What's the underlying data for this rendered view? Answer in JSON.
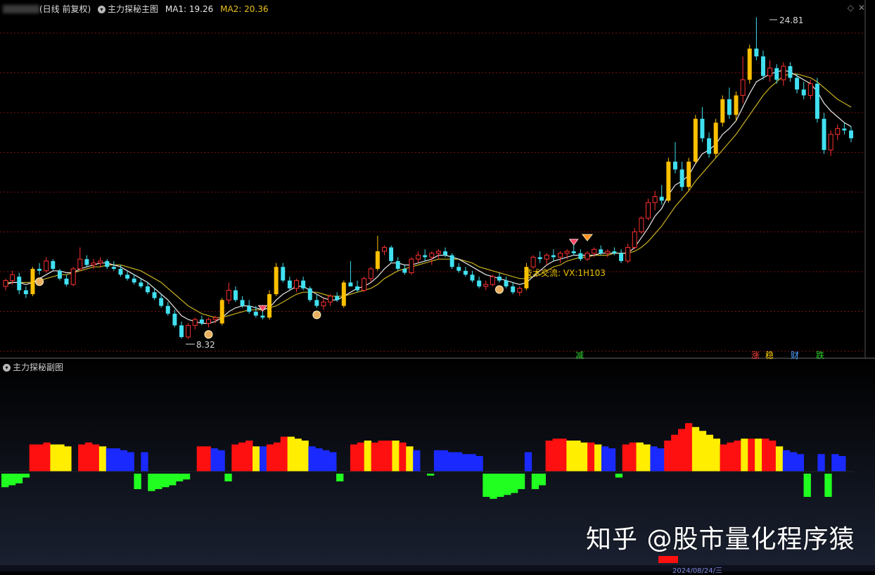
{
  "header": {
    "period_label": "(日线 前复权)",
    "indicator_name": "主力探秘主图",
    "ma1": "MA1: 19.26",
    "ma2": "MA2: 20.36"
  },
  "main_chart": {
    "high_label": "24.81",
    "low_label": "8.32",
    "annotation": "技术交流: VX:1H103",
    "signals": [
      {
        "text": "减",
        "color": "#30d030"
      },
      {
        "text": "涨",
        "color": "#ff4040"
      },
      {
        "text": "稳",
        "color": "#ffd000"
      },
      {
        "text": "财",
        "color": "#4aa0ff"
      },
      {
        "text": "跌",
        "color": "#30d030"
      }
    ]
  },
  "sub_chart": {
    "title": "主力探秘副图"
  },
  "watermark": "知乎 @股市量化程序猿",
  "footer": {
    "date_label": "2024/08/24/三"
  },
  "chart_data": {
    "type": "candlestick",
    "price_range": [
      6,
      26
    ],
    "ma1_color": "#e8e8e8",
    "ma2_color": "#c8b020",
    "candles": [
      [
        11.0,
        11.4,
        10.8,
        11.3
      ],
      [
        11.3,
        11.8,
        11.1,
        11.6
      ],
      [
        11.5,
        11.7,
        10.6,
        10.8
      ],
      [
        10.8,
        11.0,
        10.4,
        10.6
      ],
      [
        10.6,
        12.0,
        10.5,
        11.9
      ],
      [
        11.9,
        12.2,
        11.6,
        11.8
      ],
      [
        11.8,
        12.5,
        11.7,
        12.3
      ],
      [
        12.3,
        12.4,
        11.8,
        11.9
      ],
      [
        11.8,
        11.9,
        11.3,
        11.4
      ],
      [
        11.4,
        11.6,
        11.0,
        11.1
      ],
      [
        11.1,
        12.0,
        11.0,
        11.9
      ],
      [
        11.9,
        13.0,
        11.8,
        12.4
      ],
      [
        12.4,
        12.6,
        12.0,
        12.1
      ],
      [
        12.1,
        12.4,
        11.9,
        12.2
      ],
      [
        12.2,
        12.5,
        12.0,
        12.3
      ],
      [
        12.3,
        12.4,
        11.9,
        12.0
      ],
      [
        12.0,
        12.3,
        11.8,
        11.9
      ],
      [
        11.9,
        12.1,
        11.5,
        11.6
      ],
      [
        11.6,
        11.8,
        11.3,
        11.4
      ],
      [
        11.4,
        11.6,
        11.1,
        11.2
      ],
      [
        11.2,
        11.4,
        10.9,
        11.0
      ],
      [
        11.0,
        11.2,
        10.6,
        10.7
      ],
      [
        10.7,
        10.9,
        10.3,
        10.4
      ],
      [
        10.4,
        10.6,
        9.9,
        10.0
      ],
      [
        10.0,
        10.2,
        9.5,
        9.6
      ],
      [
        9.6,
        9.8,
        8.9,
        9.0
      ],
      [
        9.0,
        9.2,
        8.32,
        8.4
      ],
      [
        8.4,
        9.1,
        8.3,
        9.0
      ],
      [
        9.0,
        9.4,
        8.8,
        9.3
      ],
      [
        9.3,
        9.5,
        9.0,
        9.1
      ],
      [
        9.1,
        9.4,
        8.9,
        9.3
      ],
      [
        9.3,
        9.5,
        9.1,
        9.4
      ],
      [
        9.1,
        10.4,
        9.0,
        10.3
      ],
      [
        10.3,
        11.2,
        10.1,
        10.8
      ],
      [
        10.8,
        11.0,
        10.2,
        10.3
      ],
      [
        10.3,
        10.5,
        9.9,
        10.0
      ],
      [
        10.0,
        10.3,
        9.6,
        9.7
      ],
      [
        9.7,
        10.0,
        9.4,
        9.5
      ],
      [
        9.5,
        9.8,
        9.3,
        9.4
      ],
      [
        9.4,
        10.8,
        9.3,
        10.6
      ],
      [
        10.6,
        12.2,
        10.5,
        12.0
      ],
      [
        12.0,
        12.2,
        11.2,
        11.3
      ],
      [
        11.3,
        11.5,
        10.8,
        10.9
      ],
      [
        10.9,
        11.4,
        10.7,
        11.3
      ],
      [
        11.3,
        11.5,
        10.8,
        10.9
      ],
      [
        10.9,
        11.0,
        10.2,
        10.3
      ],
      [
        10.3,
        10.6,
        9.9,
        10.0
      ],
      [
        10.0,
        10.4,
        9.8,
        10.2
      ],
      [
        10.2,
        10.6,
        10.0,
        10.5
      ],
      [
        10.5,
        10.7,
        10.2,
        10.3
      ],
      [
        10.0,
        11.3,
        9.9,
        11.2
      ],
      [
        11.2,
        12.3,
        11.0,
        11.0
      ],
      [
        11.0,
        11.3,
        10.7,
        10.8
      ],
      [
        10.8,
        11.5,
        10.7,
        11.4
      ],
      [
        11.4,
        12.0,
        11.2,
        11.9
      ],
      [
        11.9,
        13.6,
        11.8,
        12.8
      ],
      [
        12.8,
        13.1,
        12.6,
        13.0
      ],
      [
        13.0,
        13.1,
        12.2,
        12.3
      ],
      [
        12.3,
        12.5,
        11.8,
        11.9
      ],
      [
        11.9,
        12.1,
        11.6,
        11.7
      ],
      [
        11.7,
        12.5,
        11.6,
        12.4
      ],
      [
        12.4,
        12.8,
        12.2,
        12.6
      ],
      [
        12.6,
        12.9,
        12.3,
        12.5
      ],
      [
        12.5,
        12.8,
        12.1,
        12.7
      ],
      [
        12.7,
        12.9,
        12.4,
        12.8
      ],
      [
        12.8,
        13.0,
        12.5,
        12.6
      ],
      [
        12.6,
        12.7,
        11.9,
        12.0
      ],
      [
        12.0,
        12.2,
        11.7,
        11.8
      ],
      [
        11.8,
        12.0,
        11.5,
        11.6
      ],
      [
        11.6,
        11.8,
        11.2,
        11.3
      ],
      [
        11.3,
        11.5,
        10.9,
        11.0
      ],
      [
        11.0,
        11.3,
        10.8,
        11.1
      ],
      [
        11.1,
        11.6,
        11.0,
        11.5
      ],
      [
        11.5,
        11.7,
        11.2,
        11.3
      ],
      [
        11.3,
        11.5,
        10.9,
        11.0
      ],
      [
        11.0,
        11.2,
        10.6,
        10.7
      ],
      [
        10.7,
        11.0,
        10.5,
        10.9
      ],
      [
        10.9,
        12.2,
        10.8,
        12.0
      ],
      [
        12.0,
        12.6,
        11.9,
        12.5
      ],
      [
        12.5,
        12.8,
        12.2,
        12.4
      ],
      [
        12.4,
        12.7,
        12.1,
        12.6
      ],
      [
        12.6,
        12.9,
        12.3,
        12.5
      ],
      [
        12.5,
        12.8,
        12.2,
        12.7
      ],
      [
        12.7,
        12.9,
        12.4,
        12.8
      ],
      [
        12.8,
        13.2,
        12.6,
        12.7
      ],
      [
        12.7,
        12.9,
        12.3,
        12.4
      ],
      [
        12.4,
        12.8,
        12.3,
        12.7
      ],
      [
        12.7,
        13.0,
        12.5,
        12.9
      ],
      [
        12.9,
        13.1,
        12.6,
        12.7
      ],
      [
        12.7,
        12.9,
        12.5,
        12.8
      ],
      [
        12.8,
        13.0,
        12.6,
        12.7
      ],
      [
        12.7,
        12.9,
        12.2,
        12.3
      ],
      [
        12.3,
        13.2,
        12.2,
        13.0
      ],
      [
        13.0,
        14.0,
        12.9,
        13.8
      ],
      [
        13.8,
        14.6,
        13.7,
        14.5
      ],
      [
        14.5,
        15.5,
        14.4,
        15.3
      ],
      [
        15.3,
        15.9,
        14.9,
        15.6
      ],
      [
        15.6,
        16.2,
        15.2,
        15.4
      ],
      [
        15.4,
        17.6,
        15.3,
        17.4
      ],
      [
        17.4,
        18.4,
        16.8,
        17.0
      ],
      [
        17.0,
        17.4,
        15.9,
        16.1
      ],
      [
        16.1,
        17.6,
        15.9,
        17.4
      ],
      [
        17.4,
        19.8,
        17.3,
        19.6
      ],
      [
        19.6,
        20.2,
        18.4,
        18.6
      ],
      [
        18.6,
        18.9,
        17.6,
        17.8
      ],
      [
        17.8,
        19.6,
        17.6,
        19.4
      ],
      [
        19.4,
        20.8,
        19.2,
        20.6
      ],
      [
        20.6,
        21.2,
        19.6,
        19.8
      ],
      [
        19.8,
        21.0,
        19.5,
        20.8
      ],
      [
        20.8,
        22.8,
        20.4,
        21.6
      ],
      [
        21.6,
        23.4,
        21.4,
        23.2
      ],
      [
        23.2,
        24.81,
        22.6,
        22.8
      ],
      [
        22.8,
        23.1,
        21.6,
        21.8
      ],
      [
        21.8,
        22.6,
        21.5,
        22.2
      ],
      [
        22.2,
        22.4,
        21.4,
        21.6
      ],
      [
        21.6,
        22.5,
        21.3,
        22.3
      ],
      [
        22.3,
        22.5,
        21.5,
        21.7
      ],
      [
        21.7,
        21.9,
        20.9,
        21.1
      ],
      [
        21.1,
        21.5,
        20.6,
        20.8
      ],
      [
        20.8,
        21.6,
        20.6,
        21.4
      ],
      [
        21.4,
        21.7,
        19.4,
        19.6
      ],
      [
        19.6,
        19.9,
        17.8,
        18.0
      ],
      [
        18.0,
        19.0,
        17.7,
        18.8
      ],
      [
        18.8,
        19.3,
        18.5,
        19.1
      ],
      [
        19.1,
        19.4,
        18.8,
        19.0
      ],
      [
        19.0,
        19.2,
        18.4,
        18.6
      ]
    ],
    "ma1": [
      11.1,
      11.2,
      11.2,
      11.1,
      11.2,
      11.4,
      11.6,
      11.8,
      11.8,
      11.7,
      11.7,
      11.9,
      12.0,
      12.1,
      12.2,
      12.2,
      12.1,
      12.0,
      11.8,
      11.6,
      11.4,
      11.2,
      10.9,
      10.6,
      10.3,
      9.9,
      9.5,
      9.3,
      9.2,
      9.1,
      9.1,
      9.2,
      9.4,
      9.7,
      9.9,
      10.0,
      10.0,
      9.9,
      9.8,
      9.9,
      10.3,
      10.6,
      10.8,
      11.0,
      11.0,
      10.8,
      10.6,
      10.4,
      10.3,
      10.3,
      10.5,
      10.7,
      10.9,
      11.0,
      11.2,
      11.5,
      11.9,
      12.2,
      12.2,
      12.1,
      12.1,
      12.2,
      12.3,
      12.4,
      12.6,
      12.6,
      12.5,
      12.4,
      12.2,
      12.0,
      11.8,
      11.6,
      11.5,
      11.4,
      11.3,
      11.2,
      11.1,
      11.2,
      11.5,
      11.8,
      12.1,
      12.3,
      12.4,
      12.5,
      12.6,
      12.6,
      12.6,
      12.6,
      12.7,
      12.7,
      12.7,
      12.7,
      12.7,
      13.0,
      13.5,
      14.0,
      14.6,
      15.0,
      15.7,
      16.2,
      16.4,
      16.7,
      17.3,
      17.8,
      18.0,
      18.3,
      18.8,
      19.1,
      19.5,
      20.2,
      20.9,
      21.5,
      21.7,
      21.9,
      22.0,
      22.1,
      22.0,
      21.8,
      21.6,
      21.4,
      21.0,
      20.4,
      20.0,
      19.7,
      19.4,
      19.2
    ],
    "ma2": [
      11.2,
      11.2,
      11.2,
      11.2,
      11.2,
      11.3,
      11.4,
      11.5,
      11.6,
      11.6,
      11.7,
      11.8,
      11.9,
      12.0,
      12.0,
      12.1,
      12.1,
      12.1,
      12.0,
      11.9,
      11.8,
      11.6,
      11.4,
      11.2,
      10.9,
      10.6,
      10.3,
      10.0,
      9.8,
      9.6,
      9.5,
      9.4,
      9.4,
      9.5,
      9.6,
      9.7,
      9.8,
      9.8,
      9.8,
      9.9,
      10.0,
      10.2,
      10.4,
      10.6,
      10.7,
      10.7,
      10.7,
      10.6,
      10.5,
      10.5,
      10.5,
      10.6,
      10.7,
      10.8,
      10.9,
      11.1,
      11.4,
      11.6,
      11.8,
      11.9,
      12.0,
      12.1,
      12.2,
      12.3,
      12.4,
      12.4,
      12.4,
      12.4,
      12.3,
      12.2,
      12.0,
      11.9,
      11.8,
      11.7,
      11.6,
      11.5,
      11.4,
      11.4,
      11.5,
      11.6,
      11.8,
      12.0,
      12.1,
      12.3,
      12.4,
      12.5,
      12.5,
      12.6,
      12.6,
      12.6,
      12.7,
      12.7,
      12.7,
      12.8,
      13.0,
      13.3,
      13.7,
      14.1,
      14.6,
      15.1,
      15.5,
      15.9,
      16.4,
      16.8,
      17.2,
      17.6,
      18.0,
      18.4,
      18.8,
      19.3,
      19.8,
      20.3,
      20.8,
      21.2,
      21.5,
      21.8,
      21.9,
      21.9,
      21.8,
      21.7,
      21.5,
      21.2,
      20.9,
      20.6,
      20.4,
      20.2
    ],
    "sub_bars": [
      [
        -0.35,
        "g"
      ],
      [
        -0.3,
        "g"
      ],
      [
        -0.25,
        "g"
      ],
      [
        -0.1,
        "g"
      ],
      [
        0.7,
        "r"
      ],
      [
        0.7,
        "r"
      ],
      [
        0.75,
        "r"
      ],
      [
        0.7,
        "y"
      ],
      [
        0.7,
        "y"
      ],
      [
        0.65,
        "y"
      ],
      [
        0.0,
        "n"
      ],
      [
        0.7,
        "r"
      ],
      [
        0.75,
        "r"
      ],
      [
        0.7,
        "r"
      ],
      [
        0.65,
        "y"
      ],
      [
        0.6,
        "b"
      ],
      [
        0.6,
        "b"
      ],
      [
        0.55,
        "b"
      ],
      [
        0.5,
        "b"
      ],
      [
        -0.4,
        "g"
      ],
      [
        0.5,
        "b"
      ],
      [
        -0.45,
        "g"
      ],
      [
        -0.4,
        "g"
      ],
      [
        -0.35,
        "g"
      ],
      [
        -0.3,
        "g"
      ],
      [
        -0.2,
        "g"
      ],
      [
        -0.15,
        "g"
      ],
      [
        0.0,
        "n"
      ],
      [
        0.65,
        "r"
      ],
      [
        0.65,
        "r"
      ],
      [
        0.6,
        "b"
      ],
      [
        0.55,
        "b"
      ],
      [
        -0.2,
        "g"
      ],
      [
        0.7,
        "r"
      ],
      [
        0.75,
        "r"
      ],
      [
        0.8,
        "r"
      ],
      [
        0.65,
        "y"
      ],
      [
        0.65,
        "b"
      ],
      [
        0.7,
        "r"
      ],
      [
        0.75,
        "r"
      ],
      [
        0.9,
        "r"
      ],
      [
        0.9,
        "y"
      ],
      [
        0.85,
        "y"
      ],
      [
        0.8,
        "y"
      ],
      [
        0.65,
        "b"
      ],
      [
        0.6,
        "b"
      ],
      [
        0.55,
        "b"
      ],
      [
        0.5,
        "b"
      ],
      [
        -0.2,
        "g"
      ],
      [
        0.0,
        "n"
      ],
      [
        0.7,
        "r"
      ],
      [
        0.75,
        "r"
      ],
      [
        0.8,
        "y"
      ],
      [
        0.75,
        "r"
      ],
      [
        0.8,
        "r"
      ],
      [
        0.8,
        "r"
      ],
      [
        0.8,
        "y"
      ],
      [
        0.75,
        "r"
      ],
      [
        0.65,
        "y"
      ],
      [
        0.55,
        "b"
      ],
      [
        0.0,
        "n"
      ],
      [
        -0.05,
        "g"
      ],
      [
        0.55,
        "b"
      ],
      [
        0.55,
        "b"
      ],
      [
        0.5,
        "b"
      ],
      [
        0.5,
        "b"
      ],
      [
        0.45,
        "b"
      ],
      [
        0.45,
        "b"
      ],
      [
        0.4,
        "b"
      ],
      [
        -0.6,
        "g"
      ],
      [
        -0.65,
        "g"
      ],
      [
        -0.6,
        "g"
      ],
      [
        -0.55,
        "g"
      ],
      [
        -0.5,
        "g"
      ],
      [
        -0.4,
        "g"
      ],
      [
        0.5,
        "b"
      ],
      [
        -0.4,
        "g"
      ],
      [
        -0.3,
        "g"
      ],
      [
        0.8,
        "r"
      ],
      [
        0.85,
        "r"
      ],
      [
        0.85,
        "r"
      ],
      [
        0.8,
        "y"
      ],
      [
        0.8,
        "y"
      ],
      [
        0.75,
        "y"
      ],
      [
        0.75,
        "r"
      ],
      [
        0.7,
        "y"
      ],
      [
        0.65,
        "b"
      ],
      [
        0.6,
        "b"
      ],
      [
        -0.1,
        "g"
      ],
      [
        0.7,
        "r"
      ],
      [
        0.75,
        "r"
      ],
      [
        0.75,
        "y"
      ],
      [
        0.7,
        "y"
      ],
      [
        0.65,
        "b"
      ],
      [
        0.6,
        "b"
      ],
      [
        0.8,
        "r"
      ],
      [
        0.95,
        "r"
      ],
      [
        1.1,
        "r"
      ],
      [
        1.25,
        "r"
      ],
      [
        1.15,
        "y"
      ],
      [
        1.05,
        "y"
      ],
      [
        0.95,
        "y"
      ],
      [
        0.85,
        "y"
      ],
      [
        0.7,
        "r"
      ],
      [
        0.75,
        "r"
      ],
      [
        0.8,
        "r"
      ],
      [
        0.85,
        "y"
      ],
      [
        0.85,
        "r"
      ],
      [
        0.85,
        "y"
      ],
      [
        0.85,
        "r"
      ],
      [
        0.8,
        "r"
      ],
      [
        0.65,
        "y"
      ],
      [
        0.55,
        "b"
      ],
      [
        0.5,
        "b"
      ],
      [
        0.45,
        "b"
      ],
      [
        -0.6,
        "g"
      ],
      [
        0.0,
        "n"
      ],
      [
        0.45,
        "b"
      ],
      [
        -0.6,
        "g"
      ],
      [
        0.45,
        "b"
      ],
      [
        0.4,
        "b"
      ],
      [
        0.0,
        "n"
      ]
    ]
  }
}
